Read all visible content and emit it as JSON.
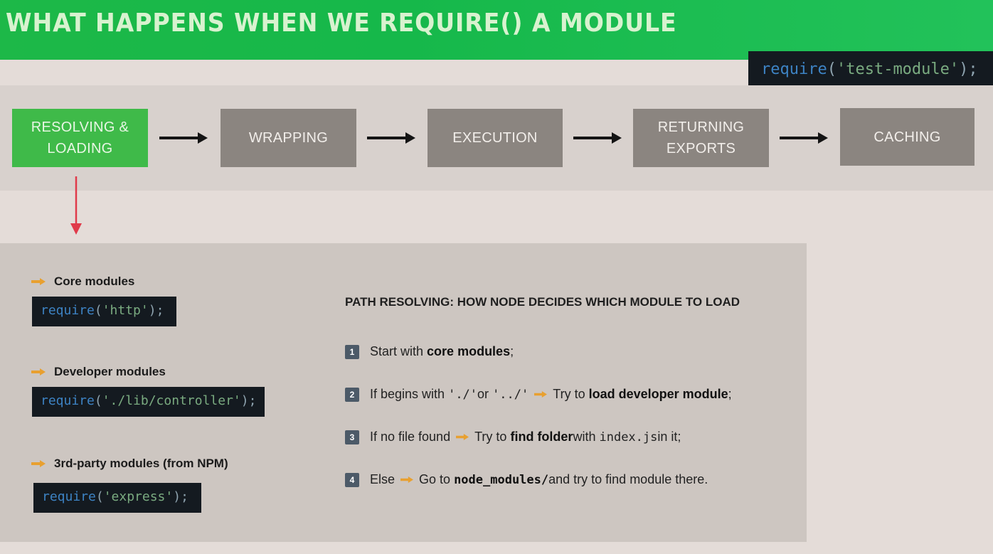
{
  "title": "WHAT HAPPENS WHEN WE REQUIRE() A MODULE",
  "header_code": {
    "fn": "require",
    "open": "(",
    "arg": "'test-module'",
    "close": ");"
  },
  "pipeline": [
    {
      "line1": "RESOLVING &",
      "line2": "LOADING",
      "active": true
    },
    {
      "line1": "WRAPPING",
      "line2": ""
    },
    {
      "line1": "EXECUTION",
      "line2": ""
    },
    {
      "line1": "RETURNING",
      "line2": "EXPORTS"
    },
    {
      "line1": "CACHING",
      "line2": ""
    }
  ],
  "modules": [
    {
      "label": "Core modules",
      "fn": "require",
      "open": "(",
      "arg": "'http'",
      "close": ");"
    },
    {
      "label": "Developer modules",
      "fn": "require",
      "open": "(",
      "arg": "'./lib/controller'",
      "close": ");"
    },
    {
      "label": "3rd-party modules (from NPM)",
      "fn": "require",
      "open": "(",
      "arg": "'express'",
      "close": ");"
    }
  ],
  "path_heading": "PATH RESOLVING: HOW NODE DECIDES WHICH MODULE TO LOAD",
  "steps": [
    {
      "num": "1",
      "a": "Start with ",
      "b": "core modules",
      "c": ";"
    },
    {
      "num": "2",
      "a": "If begins with ",
      "code1": "'./'",
      "or": " or ",
      "code2": "'../'",
      "d": "Try to ",
      "b": "load developer module",
      "c": ";"
    },
    {
      "num": "3",
      "a": "If no file found",
      "d": "Try to ",
      "b": "find folder",
      "e": " with ",
      "code": "index.js",
      "c": " in it;"
    },
    {
      "num": "4",
      "a": "Else",
      "d": "Go to ",
      "code": "node_modules/",
      "c": " and try to find module there."
    }
  ],
  "colors": {
    "title_green": "#1db848",
    "active_stage": "#3fba49",
    "stage_gray": "#8b8580",
    "code_bg": "#141a20",
    "arrow_red": "#e03a4a",
    "pointer_orange": "#e8a030"
  },
  "icons": [
    "right-arrow-icon",
    "down-arrow-icon",
    "pointing-hand-icon",
    "step-number-badge"
  ]
}
